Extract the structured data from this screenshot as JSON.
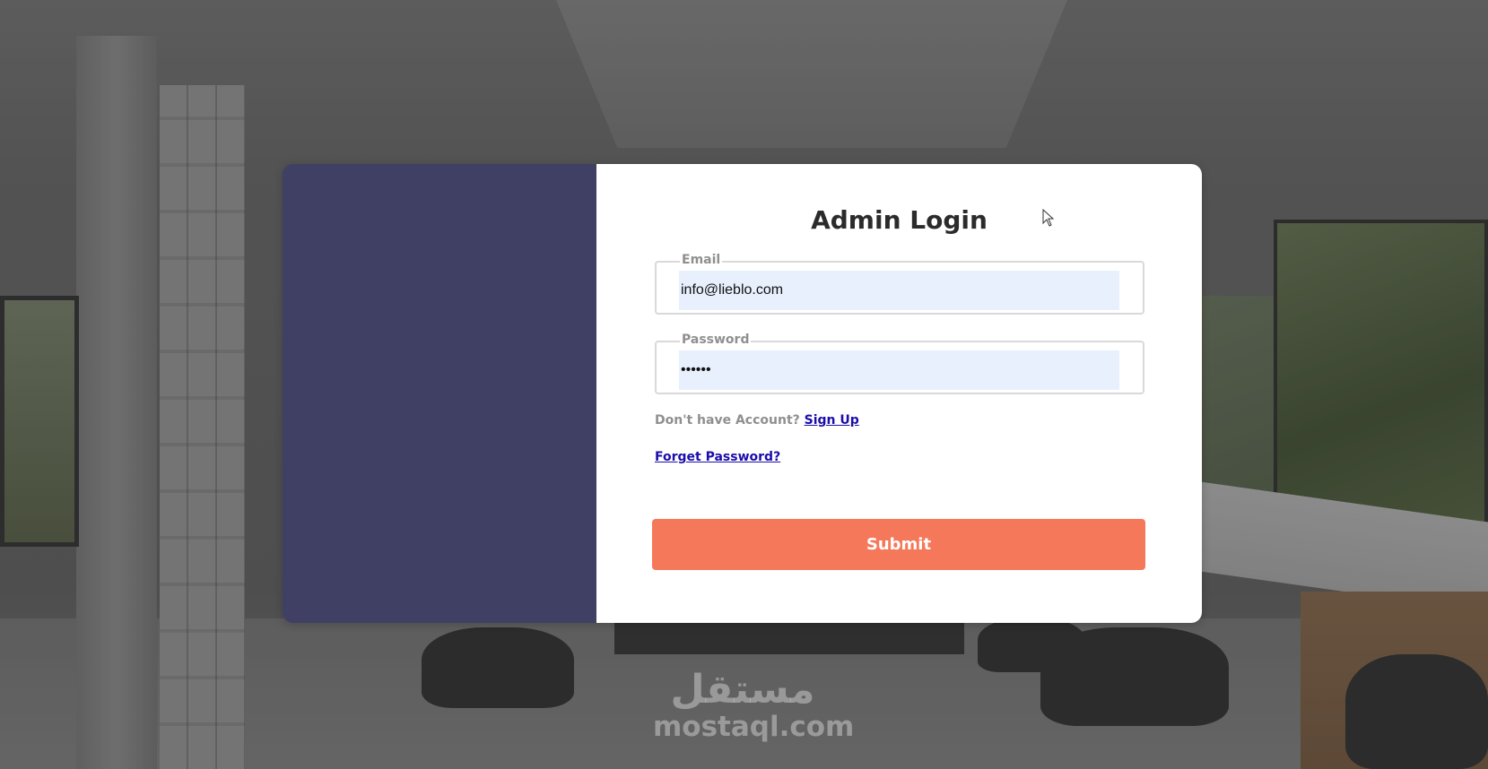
{
  "login": {
    "title": "Admin Login",
    "email": {
      "label": "Email",
      "value": "info@lieblo.com"
    },
    "password": {
      "label": "Password",
      "value": "••••••"
    },
    "signup_prompt": "Don't have Account?",
    "signup_link": "Sign Up",
    "forgot_link": "Forget Password?",
    "submit_label": "Submit"
  },
  "watermark": {
    "arabic": "مستقل",
    "latin": "mostaql.com"
  },
  "colors": {
    "side_panel": "#3f4064",
    "submit": "#f5785a",
    "input_bg": "#e8f0fe",
    "link": "#1a0dab"
  },
  "icons": {
    "cursor": "mouse-pointer-icon"
  }
}
